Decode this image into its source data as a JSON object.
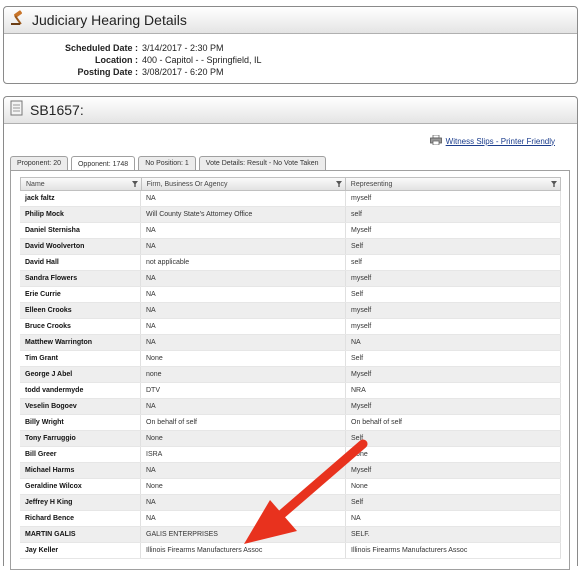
{
  "header": {
    "title": "Judiciary Hearing Details",
    "icon": "gavel-icon"
  },
  "hearing": {
    "scheduled_label": "Scheduled Date :",
    "scheduled_value": "3/14/2017 - 2:30 PM",
    "location_label": "Location :",
    "location_value": "400 - Capitol - - Springfield, IL",
    "posting_label": "Posting Date :",
    "posting_value": "3/08/2017 - 6:20 PM"
  },
  "bill": {
    "title": "SB1657:",
    "icon": "document-icon"
  },
  "witness_link": "Witness Slips - Printer Friendly",
  "tabs": [
    {
      "label": "Proponent: 20"
    },
    {
      "label": "Opponent: 1748"
    },
    {
      "label": "No Position: 1"
    },
    {
      "label": "Vote Details: Result - No Vote Taken"
    }
  ],
  "columns": [
    "Name",
    "Firm, Business Or Agency",
    "Representing"
  ],
  "rows": [
    [
      "jack faltz",
      "NA",
      "myself"
    ],
    [
      "Philip Mock",
      "Will County State's Attorney Office",
      "self"
    ],
    [
      "Daniel Sternisha",
      "NA",
      "Myself"
    ],
    [
      "David Woolverton",
      "NA",
      "Self"
    ],
    [
      "David Hall",
      "not applicable",
      "self"
    ],
    [
      "Sandra Flowers",
      "NA",
      "myself"
    ],
    [
      "Erie Currie",
      "NA",
      "Self"
    ],
    [
      "Elleen Crooks",
      "NA",
      "myself"
    ],
    [
      "Bruce Crooks",
      "NA",
      "myself"
    ],
    [
      "Matthew Warrington",
      "NA",
      "NA"
    ],
    [
      "Tim Grant",
      "None",
      "Self"
    ],
    [
      "George J Abel",
      "none",
      "Myself"
    ],
    [
      "todd vandermyde",
      "DTV",
      "NRA"
    ],
    [
      "Veselin Bogoev",
      "NA",
      "Myself"
    ],
    [
      "Billy Wright",
      "On behalf of self",
      "On behalf of self"
    ],
    [
      "Tony Farruggio",
      "None",
      "Self"
    ],
    [
      "Bill Greer",
      "ISRA",
      "None"
    ],
    [
      "Michael Harms",
      "NA",
      "Myself"
    ],
    [
      "Geraldine Wilcox",
      "None",
      "None"
    ],
    [
      "Jeffrey H King",
      "NA",
      "Self"
    ],
    [
      "Richard Bence",
      "NA",
      "NA"
    ],
    [
      "MARTIN GALIS",
      "GALIS ENTERPRISES",
      "SELF."
    ],
    [
      "Jay Keller",
      "Illinois Firearms Manufacturers Assoc",
      "Illinois Firearms Manufacturers Assoc"
    ]
  ],
  "colors": {
    "annotation_arrow": "#e8321e"
  }
}
